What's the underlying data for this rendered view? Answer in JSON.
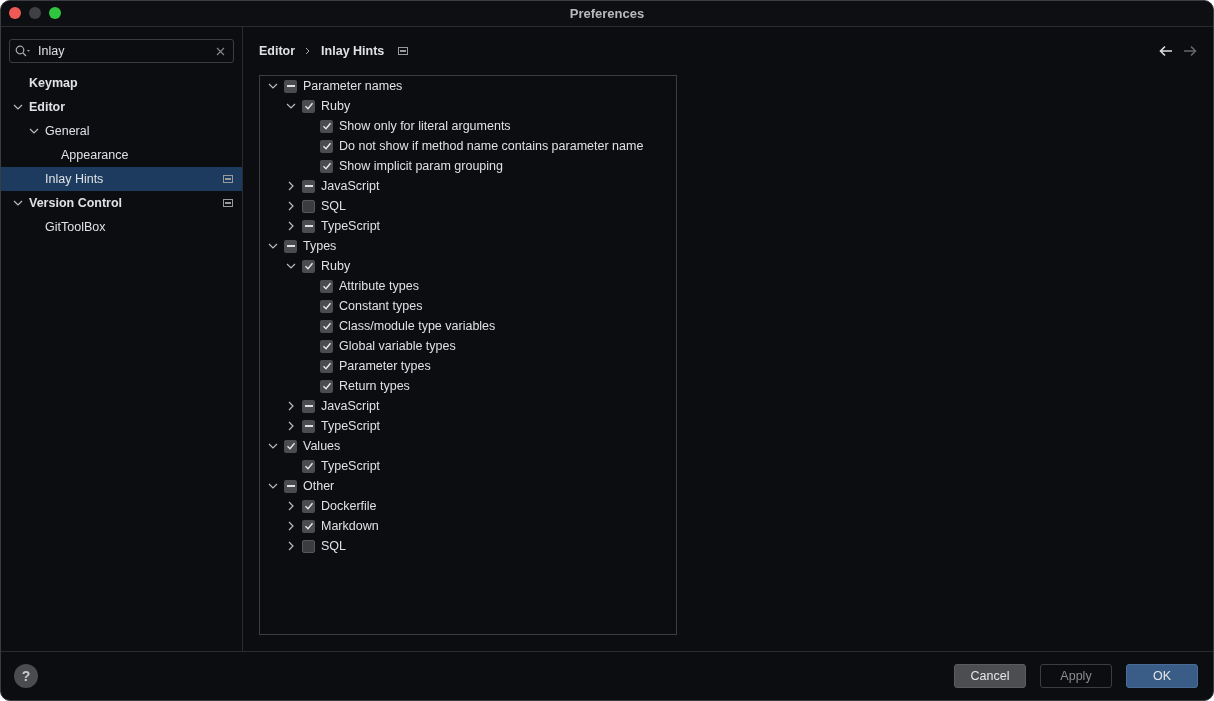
{
  "window": {
    "title": "Preferences"
  },
  "search": {
    "value": "Inlay"
  },
  "sidebar": {
    "items": [
      {
        "label": "Keymap",
        "bold": true,
        "selected": false,
        "project_icon": false
      },
      {
        "label": "Editor",
        "bold": true,
        "selected": false,
        "expanded": true,
        "project_icon": false,
        "children": [
          {
            "label": "General",
            "bold": false,
            "selected": false,
            "expanded": true,
            "project_icon": false,
            "children": [
              {
                "label": "Appearance",
                "bold": false,
                "selected": false,
                "project_icon": false
              }
            ]
          },
          {
            "label": "Inlay Hints",
            "bold": false,
            "selected": true,
            "project_icon": true
          }
        ]
      },
      {
        "label": "Version Control",
        "bold": true,
        "selected": false,
        "expanded": true,
        "project_icon": true,
        "children": [
          {
            "label": "GitToolBox",
            "bold": false,
            "selected": false,
            "project_icon": false
          }
        ]
      }
    ]
  },
  "breadcrumb": {
    "items": [
      "Editor",
      "Inlay Hints"
    ],
    "project_icon": true
  },
  "navigation": {
    "back_enabled": true,
    "forward_enabled": false
  },
  "tree": [
    {
      "label": "Parameter names",
      "checked": false,
      "mixed": true,
      "expanded": true,
      "children": [
        {
          "label": "Ruby",
          "checked": true,
          "mixed": false,
          "expanded": true,
          "children": [
            {
              "label": "Show only for literal arguments",
              "checked": true,
              "mixed": false
            },
            {
              "label": "Do not show if method name contains parameter name",
              "checked": true,
              "mixed": false
            },
            {
              "label": "Show implicit param grouping",
              "checked": true,
              "mixed": false
            }
          ]
        },
        {
          "label": "JavaScript",
          "checked": false,
          "mixed": true,
          "expanded": false
        },
        {
          "label": "SQL",
          "checked": false,
          "mixed": false,
          "expanded": false
        },
        {
          "label": "TypeScript",
          "checked": false,
          "mixed": true,
          "expanded": false
        }
      ]
    },
    {
      "label": "Types",
      "checked": false,
      "mixed": true,
      "expanded": true,
      "children": [
        {
          "label": "Ruby",
          "checked": true,
          "mixed": false,
          "expanded": true,
          "children": [
            {
              "label": "Attribute types",
              "checked": true,
              "mixed": false
            },
            {
              "label": "Constant types",
              "checked": true,
              "mixed": false
            },
            {
              "label": "Class/module type variables",
              "checked": true,
              "mixed": false
            },
            {
              "label": "Global variable types",
              "checked": true,
              "mixed": false
            },
            {
              "label": "Parameter types",
              "checked": true,
              "mixed": false
            },
            {
              "label": "Return types",
              "checked": true,
              "mixed": false
            }
          ]
        },
        {
          "label": "JavaScript",
          "checked": false,
          "mixed": true,
          "expanded": false
        },
        {
          "label": "TypeScript",
          "checked": false,
          "mixed": true,
          "expanded": false
        }
      ]
    },
    {
      "label": "Values",
      "checked": true,
      "mixed": false,
      "expanded": true,
      "children": [
        {
          "label": "TypeScript",
          "checked": true,
          "mixed": false
        }
      ]
    },
    {
      "label": "Other",
      "checked": false,
      "mixed": true,
      "expanded": true,
      "children": [
        {
          "label": "Dockerfile",
          "checked": true,
          "mixed": false,
          "expanded": false
        },
        {
          "label": "Markdown",
          "checked": true,
          "mixed": false,
          "expanded": false
        },
        {
          "label": "SQL",
          "checked": false,
          "mixed": false,
          "expanded": false
        }
      ]
    }
  ],
  "footer": {
    "help": "?",
    "buttons": [
      {
        "label": "Cancel",
        "kind": "secondary",
        "disabled": false
      },
      {
        "label": "Apply",
        "kind": "secondary",
        "disabled": true
      },
      {
        "label": "OK",
        "kind": "primary",
        "disabled": false
      }
    ]
  }
}
